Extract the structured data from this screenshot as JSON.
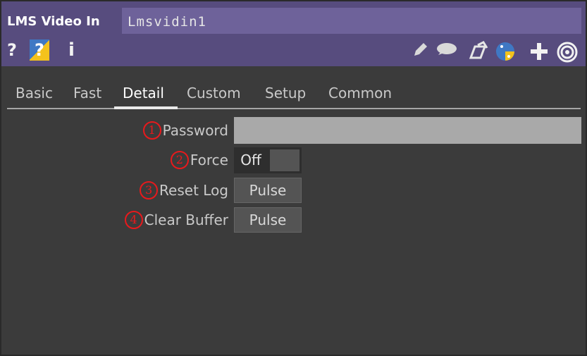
{
  "header": {
    "op_type": "LMS Video In",
    "op_name": "Lmsvidin1",
    "help_label": "?",
    "python_help_label": "?",
    "info_label": "i",
    "toolbar_icons": [
      "pencil-icon",
      "comment-icon",
      "clone-icon",
      "python-icon",
      "plus-icon",
      "target-icon"
    ]
  },
  "tabs": [
    {
      "label": "Basic"
    },
    {
      "label": "Fast"
    },
    {
      "label": "Detail"
    },
    {
      "label": "Custom"
    },
    {
      "label": "Setup"
    },
    {
      "label": "Common"
    }
  ],
  "active_tab": "Detail",
  "params": [
    {
      "number": "1",
      "label": "Password",
      "value": ""
    },
    {
      "number": "2",
      "label": "Force",
      "value": "Off"
    },
    {
      "number": "3",
      "label": "Reset Log",
      "value": "Pulse"
    },
    {
      "number": "4",
      "label": "Clear Buffer",
      "value": "Pulse"
    }
  ],
  "colors": {
    "header_bg": "#574c7e",
    "name_field_bg": "#6e629a",
    "panel_bg": "#3b3b3b",
    "annotation_red": "#e8191c"
  }
}
